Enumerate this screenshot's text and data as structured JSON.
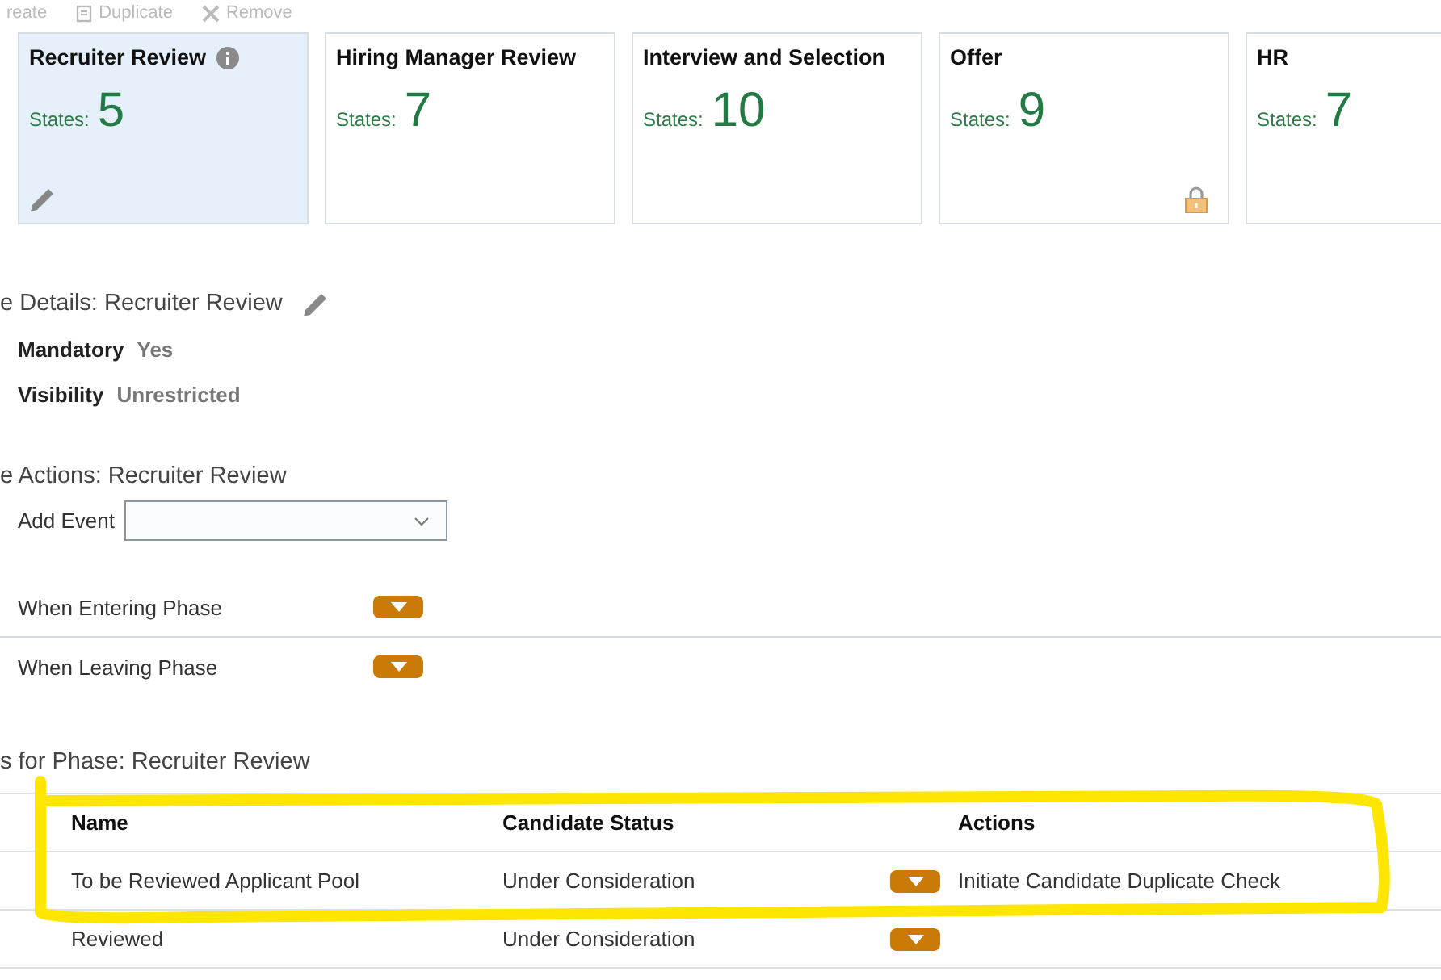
{
  "toolbar": [
    {
      "kind": "create",
      "label": "reate",
      "disabled": true
    },
    {
      "kind": "duplicate",
      "label": "Duplicate",
      "disabled": true
    },
    {
      "kind": "remove",
      "label": "Remove",
      "disabled": true
    }
  ],
  "phases": [
    {
      "name": "Recruiter Review",
      "states_label": "States:",
      "count": "5",
      "selected": true,
      "locked": false
    },
    {
      "name": "Hiring Manager Review",
      "states_label": "States:",
      "count": "7",
      "selected": false,
      "locked": false
    },
    {
      "name": "Interview and Selection",
      "states_label": "States:",
      "count": "10",
      "selected": false,
      "locked": false
    },
    {
      "name": "Offer",
      "states_label": "States:",
      "count": "9",
      "selected": false,
      "locked": true
    },
    {
      "name": "HR",
      "states_label": "States:",
      "count": "7",
      "selected": false
    }
  ],
  "details": {
    "title": "e Details: Recruiter Review",
    "fields": [
      {
        "label": "Mandatory",
        "value": "Yes"
      },
      {
        "label": "Visibility",
        "value": "Unrestricted"
      }
    ]
  },
  "actions": {
    "title": "e Actions: Recruiter Review",
    "add_event": {
      "label": "Add Event"
    },
    "events": [
      {
        "label": "When Entering Phase"
      },
      {
        "label": "When Leaving Phase"
      }
    ]
  },
  "states_table": {
    "title": "s for Phase: Recruiter Review",
    "columns": [
      "Name",
      "Candidate Status",
      "Actions"
    ],
    "rows": [
      {
        "name": "To be Reviewed Applicant Pool",
        "status": "Under Consideration",
        "action": "Initiate Candidate Duplicate Check"
      },
      {
        "name": "Reviewed",
        "status": "Under Consideration"
      }
    ]
  }
}
